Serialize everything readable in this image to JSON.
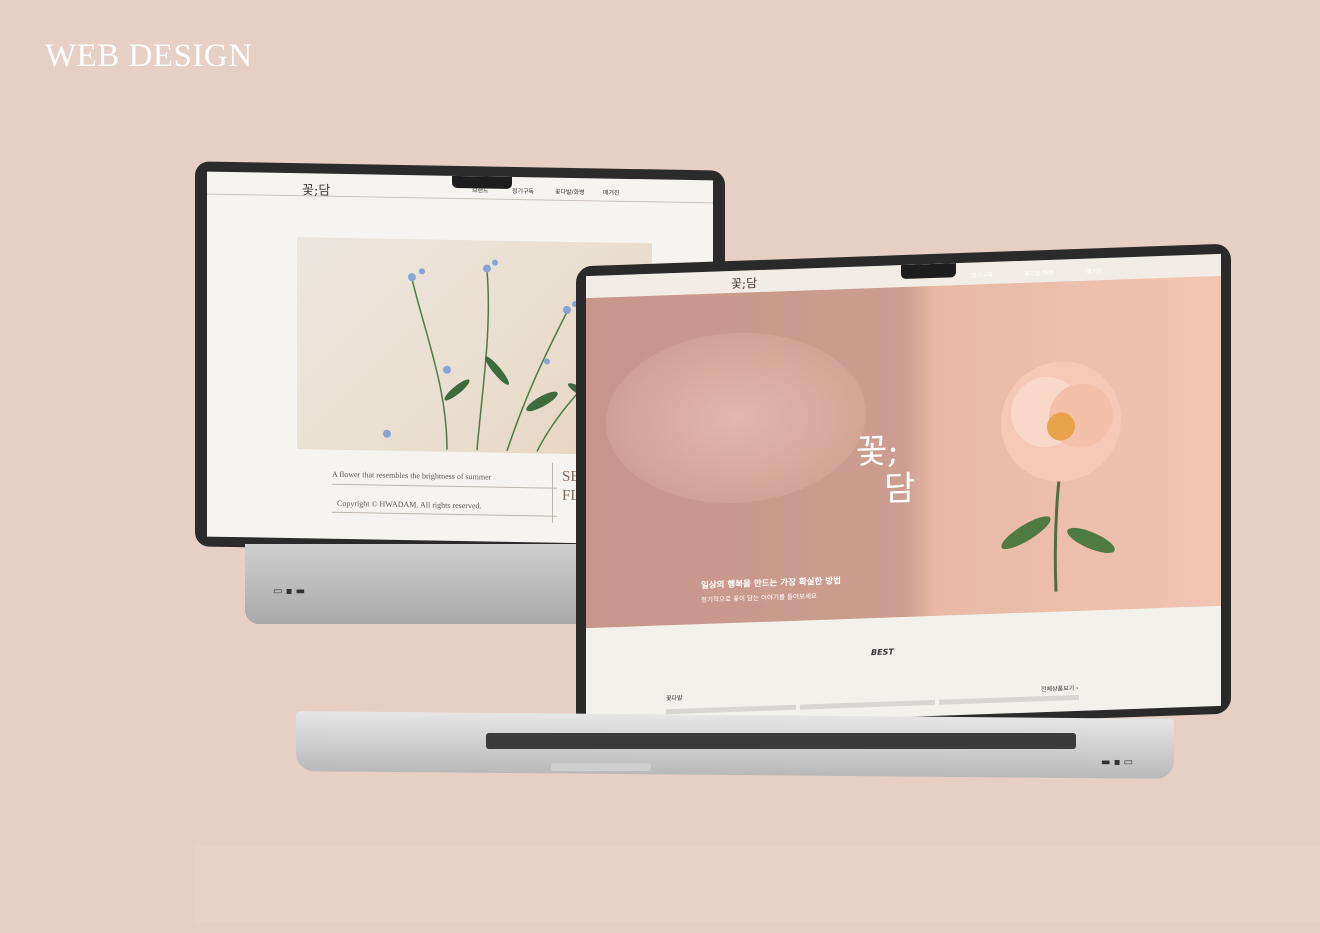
{
  "heading": "WEB DESIGN",
  "back_site": {
    "logo": "꽃;담",
    "nav": [
      "브랜드",
      "정기구독",
      "꽃다발/화병",
      "매거진"
    ],
    "tagline": "A flower that resembles the brightness of summer",
    "copyright": "Copyright © HWADAM. All rights reserved.",
    "season_line1": "SEASON",
    "season_line2": "FLOW"
  },
  "front_site": {
    "logo": "꽃;담",
    "nav": [
      "브랜드",
      "정기구독",
      "꽃다발/화병",
      "매거진"
    ],
    "hero_title_line1": "꽃;",
    "hero_title_line2": "담",
    "slogan": "일상의 행복을 만드는 가장 확실한 방법",
    "subtext": "정기적으로 꽃이 담는 이야기를 들어보세요",
    "best_label": "BEST",
    "category": "꽃다발",
    "view_all": "전체상품보기 ›"
  }
}
